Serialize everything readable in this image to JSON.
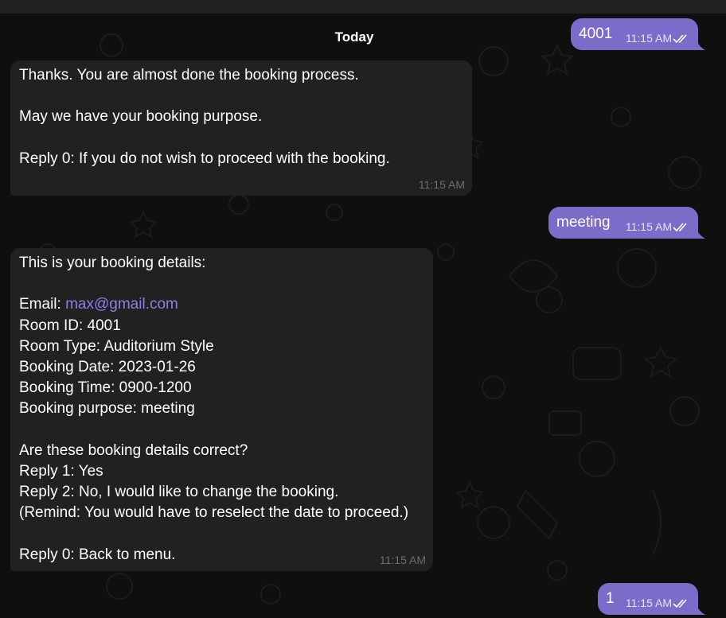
{
  "date_separator": "Today",
  "colors": {
    "incoming_bubble": "#212121",
    "outgoing_bubble": "#7b6cc9",
    "link": "#8e7ee6",
    "background": "#0f0f0f"
  },
  "messages": [
    {
      "direction": "outgoing",
      "text": "4001",
      "time": "11:15 AM",
      "status": "read"
    },
    {
      "direction": "incoming",
      "lines": [
        "Thanks. You are almost done the booking process.",
        "",
        "May we have your booking purpose.",
        "",
        "Reply 0: If you do not wish to proceed with the booking."
      ],
      "time": "11:15 AM"
    },
    {
      "direction": "outgoing",
      "text": "meeting",
      "time": "11:15 AM",
      "status": "read"
    },
    {
      "direction": "incoming",
      "intro": "This is your booking details:",
      "email_label": "Email: ",
      "email_link": "max@gmail.com",
      "lines": [
        "Room ID: 4001",
        "Room Type: Auditorium Style",
        "Booking Date: 2023-01-26",
        "Booking Time: 0900-1200",
        "Booking purpose: meeting",
        "",
        "Are these booking details correct?",
        "Reply 1: Yes",
        "Reply 2: No, I would like to change the booking.",
        "(Remind: You would have to reselect the date to proceed.)",
        "",
        "Reply 0: Back to menu."
      ],
      "time": "11:15 AM"
    },
    {
      "direction": "outgoing",
      "text": "1",
      "time": "11:15 AM",
      "status": "read"
    }
  ]
}
